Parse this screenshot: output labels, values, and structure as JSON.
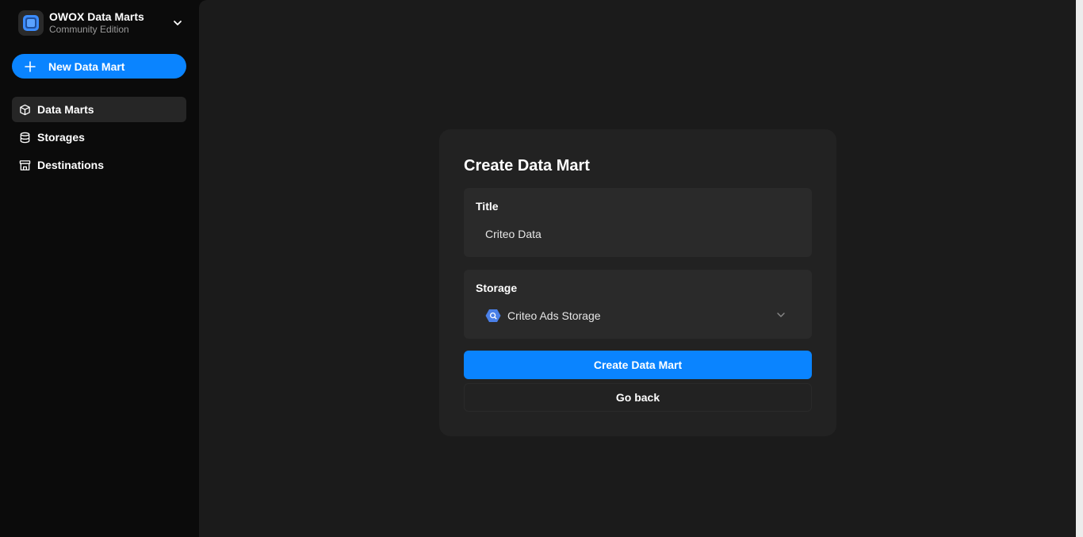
{
  "sidebar": {
    "brand": {
      "name": "OWOX Data Marts",
      "edition": "Community Edition",
      "logo_icon": "owox-logo-icon",
      "chevron_icon": "chevron-down-icon"
    },
    "new_button": {
      "label": "New Data Mart",
      "icon": "plus-icon"
    },
    "nav": [
      {
        "label": "Data Marts",
        "icon": "cube-icon",
        "active": true
      },
      {
        "label": "Storages",
        "icon": "database-icon",
        "active": false
      },
      {
        "label": "Destinations",
        "icon": "destination-icon",
        "active": false
      }
    ]
  },
  "form": {
    "heading": "Create Data Mart",
    "title_field": {
      "label": "Title",
      "value": "Criteo Data"
    },
    "storage_field": {
      "label": "Storage",
      "value": "Criteo Ads Storage",
      "icon": "bigquery-icon"
    },
    "submit_label": "Create Data Mart",
    "back_label": "Go back"
  },
  "colors": {
    "accent": "#0a84ff",
    "sidebar_bg": "#0b0b0b",
    "main_bg": "#1b1b1b",
    "card_bg": "#222222",
    "field_bg": "#2a2a2a"
  }
}
